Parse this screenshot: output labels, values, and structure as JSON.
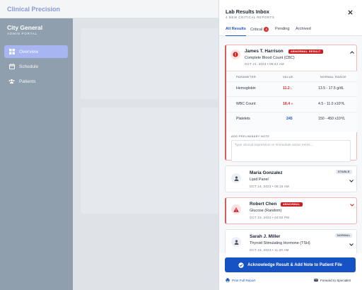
{
  "app": {
    "brand": "Clinical Precision"
  },
  "sidebar": {
    "org": "City General",
    "org_sub": "ADMIN PORTAL",
    "items": [
      {
        "label": "Overview",
        "icon": "grid-icon",
        "active": true
      },
      {
        "label": "Schedule",
        "icon": "calendar-icon",
        "active": false
      },
      {
        "label": "Patients",
        "icon": "users-icon",
        "active": false
      }
    ]
  },
  "panel": {
    "title": "Lab Results Inbox",
    "subtitle": "4 NEW CRITICAL REPORTS",
    "tabs": [
      {
        "label": "All Results",
        "active": true
      },
      {
        "label": "Critical",
        "count": "4"
      },
      {
        "label": "Pending"
      },
      {
        "label": "Archived"
      }
    ],
    "cards": [
      {
        "patient": "James T. Harrison",
        "tag": "ABNORMAL RESULT",
        "test": "Complete Blood Count (CBC)",
        "date": "OCT 24, 2023 • 09:42 AM",
        "status": "critical",
        "expanded": true,
        "table": {
          "headers": [
            "PARAMETER",
            "VALUE",
            "NORMAL RANGE"
          ],
          "rows": [
            {
              "param": "Hemoglobin",
              "value": "11.2",
              "flag": "L",
              "range": "13.5 - 17.5 g/dL",
              "color": "#d42a2a"
            },
            {
              "param": "WBC Count",
              "value": "18.4",
              "flag": "H",
              "range": "4.5 - 11.0 x10⁹/L",
              "color": "#d42a2a"
            },
            {
              "param": "Platelets",
              "value": "245",
              "flag": "",
              "range": "150 - 450 x10⁹/L",
              "color": "#1e56c9"
            }
          ]
        },
        "note_label": "ADD PRELIMINARY NOTE",
        "note_placeholder": "Type clinical impression or immediate action items..."
      },
      {
        "patient": "Maria Gonzalez",
        "tag": "STABLE",
        "test": "Lipid Panel",
        "date": "OCT 24, 2023 • 08:15 AM",
        "status": "normal"
      },
      {
        "patient": "Robert Chen",
        "tag": "ABNORMAL",
        "test": "Glucose (Random)",
        "date": "OCT 23, 2023 • 04:50 PM",
        "status": "critical"
      },
      {
        "patient": "Sarah J. Miller",
        "tag": "NORMAL",
        "test": "Thyroid Stimulating Hormone (TSH)",
        "date": "OCT 23, 2023 • 11:20 AM",
        "status": "normal"
      }
    ],
    "footer": {
      "ack_label": "Acknowledge Result & Add Note to Patient File",
      "print_label": "Print Full Report",
      "forward_label": "Forward to Specialist"
    }
  },
  "colors": {
    "primary": "#1652c4",
    "critical": "#c61f1f",
    "accent": "#1e56c9",
    "sidebar": "#909fae",
    "nav_active": "#a7b6f2"
  }
}
